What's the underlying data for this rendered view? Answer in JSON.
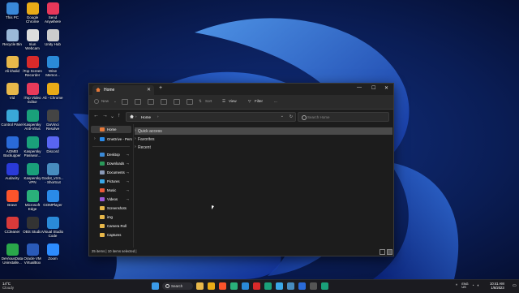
{
  "desktop_icons": [
    {
      "label": "This PC",
      "icon": "computer-icon",
      "color": "#3a88d8"
    },
    {
      "label": "Google\nChrome",
      "icon": "chrome-icon",
      "color": "#e9ab17"
    },
    {
      "label": "Send\nAnywhere",
      "icon": "send-anywhere-icon",
      "color": "#e8375a"
    },
    {
      "label": "Recycle Bin",
      "icon": "recycle-bin-icon",
      "color": "#9bb8d8"
    },
    {
      "label": "Iriun\nWebcam",
      "icon": "webcam-icon",
      "color": "#dddddd"
    },
    {
      "label": "Unity Hub",
      "icon": "unity-icon",
      "color": "#cccccc"
    },
    {
      "label": "Ali khalid",
      "icon": "folder-icon",
      "color": "#e8b84a"
    },
    {
      "label": "iTop Screen\nRecorder",
      "icon": "recorder-icon",
      "color": "#d82a2a"
    },
    {
      "label": "Wise\nMemor...",
      "icon": "memory-icon",
      "color": "#2a8ad8"
    },
    {
      "label": "Vid",
      "icon": "folder-icon",
      "color": "#e8b84a"
    },
    {
      "label": "iTop Video\nEditor",
      "icon": "video-editor-icon",
      "color": "#e83a5a"
    },
    {
      "label": "Ali - Chrome",
      "icon": "chrome-icon",
      "color": "#e9ab17"
    },
    {
      "label": "Control Panel",
      "icon": "control-panel-icon",
      "color": "#3aa8d8"
    },
    {
      "label": "Kaspersky\nAnti-Virus",
      "icon": "kaspersky-icon",
      "color": "#1aa07a"
    },
    {
      "label": "DaVinci\nResolve",
      "icon": "davinci-icon",
      "color": "#444444"
    },
    {
      "label": "AOMEI\nBackupper",
      "icon": "aomei-icon",
      "color": "#2a6ad8"
    },
    {
      "label": "Kaspersky\nPasswor...",
      "icon": "kaspersky-icon",
      "color": "#1aa07a"
    },
    {
      "label": "Discord",
      "icon": "discord-icon",
      "color": "#5865f2"
    },
    {
      "label": "Audacity",
      "icon": "audacity-icon",
      "color": "#2a3ad8"
    },
    {
      "label": "Kaspersky\nVPN",
      "icon": "kaspersky-icon",
      "color": "#1aa07a"
    },
    {
      "label": "Godot_v3.5...\n- Shortcut",
      "icon": "godot-icon",
      "color": "#478cbf"
    },
    {
      "label": "Brave",
      "icon": "brave-icon",
      "color": "#fb542b"
    },
    {
      "label": "Microsoft\nEdge",
      "icon": "edge-icon",
      "color": "#2ab07a"
    },
    {
      "label": "GOMPlayer",
      "icon": "gomplayer-icon",
      "color": "#2a8ae8"
    },
    {
      "label": "CCleaner",
      "icon": "ccleaner-icon",
      "color": "#d83a3a"
    },
    {
      "label": "OBS Studio",
      "icon": "obs-icon",
      "color": "#333333"
    },
    {
      "label": "Visual Studio\nCode",
      "icon": "vscode-icon",
      "color": "#2a8ad8"
    },
    {
      "label": "DeViousData\nUninstalle...",
      "icon": "uninstaller-icon",
      "color": "#2aa84a"
    },
    {
      "label": "Oracle VM\nVirtualBox",
      "icon": "virtualbox-icon",
      "color": "#2a5ab8"
    },
    {
      "label": "Zoom",
      "icon": "zoom-icon",
      "color": "#2d8cff"
    }
  ],
  "window": {
    "tab_title": "Home",
    "toolbar": {
      "new": "New",
      "sort": "Sort",
      "view": "View",
      "filter": "Filter",
      "more": "..."
    },
    "address": {
      "location": "Home",
      "search_placeholder": "Search Home"
    },
    "sidebar": [
      {
        "label": "Home",
        "icon": "home-icon",
        "selected": true,
        "chevron": false,
        "pinned": false,
        "color": "#e87a3a"
      },
      {
        "label": "OneDrive - Pers",
        "icon": "onedrive-icon",
        "selected": false,
        "chevron": true,
        "pinned": false,
        "color": "#2a8ae8"
      },
      {
        "label": "Desktop",
        "icon": "desktop-icon",
        "selected": false,
        "chevron": false,
        "pinned": true,
        "color": "#3a8ad8"
      },
      {
        "label": "Downloads",
        "icon": "downloads-icon",
        "selected": false,
        "chevron": false,
        "pinned": true,
        "color": "#2a9a5a"
      },
      {
        "label": "Documents",
        "icon": "documents-icon",
        "selected": false,
        "chevron": false,
        "pinned": true,
        "color": "#8a9ab8"
      },
      {
        "label": "Pictures",
        "icon": "pictures-icon",
        "selected": false,
        "chevron": false,
        "pinned": true,
        "color": "#3aa8e8"
      },
      {
        "label": "Music",
        "icon": "music-icon",
        "selected": false,
        "chevron": false,
        "pinned": true,
        "color": "#e85a3a"
      },
      {
        "label": "Videos",
        "icon": "videos-icon",
        "selected": false,
        "chevron": false,
        "pinned": true,
        "color": "#9a5ad8"
      },
      {
        "label": "Screenshots",
        "icon": "folder-icon",
        "selected": false,
        "chevron": false,
        "pinned": false,
        "color": "#e8b84a"
      },
      {
        "label": "img",
        "icon": "folder-icon",
        "selected": false,
        "chevron": false,
        "pinned": false,
        "color": "#e8b84a"
      },
      {
        "label": "Camera Roll",
        "icon": "folder-icon",
        "selected": false,
        "chevron": false,
        "pinned": false,
        "color": "#e8b84a"
      },
      {
        "label": "Captures",
        "icon": "folder-icon",
        "selected": false,
        "chevron": false,
        "pinned": false,
        "color": "#e8b84a"
      }
    ],
    "groups": [
      {
        "label": "Quick access",
        "highlighted": true
      },
      {
        "label": "Favorites",
        "highlighted": false
      },
      {
        "label": "Recent",
        "highlighted": false
      }
    ],
    "status": "25 items  |  10 items selected  |"
  },
  "taskbar": {
    "weather_temp": "14°C",
    "weather_desc": "Cloudy",
    "search_label": "Search",
    "tray_lang": "ENG\nUS",
    "time": "10:41 AM",
    "date": "1/6/2023",
    "apps": [
      {
        "icon": "start-icon",
        "color": "#3a9ae8"
      },
      {
        "icon": "explorer-icon",
        "color": "#e8b84a"
      },
      {
        "icon": "chrome-icon",
        "color": "#e9ab17"
      },
      {
        "icon": "brave-icon",
        "color": "#fb542b"
      },
      {
        "icon": "edge-icon",
        "color": "#2ab07a"
      },
      {
        "icon": "vscode-icon",
        "color": "#2a8ad8"
      },
      {
        "icon": "recorder-icon",
        "color": "#d82a2a"
      },
      {
        "icon": "kaspersky-icon",
        "color": "#1aa07a"
      },
      {
        "icon": "photos-icon",
        "color": "#3aa8e8"
      },
      {
        "icon": "godot-icon",
        "color": "#478cbf"
      },
      {
        "icon": "store-icon",
        "color": "#2a6ad8"
      },
      {
        "icon": "terminal-icon",
        "color": "#555555"
      },
      {
        "icon": "vpn-icon",
        "color": "#1aa07a"
      }
    ]
  },
  "colors": {
    "wallpaper_dark": "#0a1a45",
    "wallpaper_bloom": "#1e5ed8",
    "window_bg": "#1c1c1c",
    "selection": "#4a4a4a"
  }
}
